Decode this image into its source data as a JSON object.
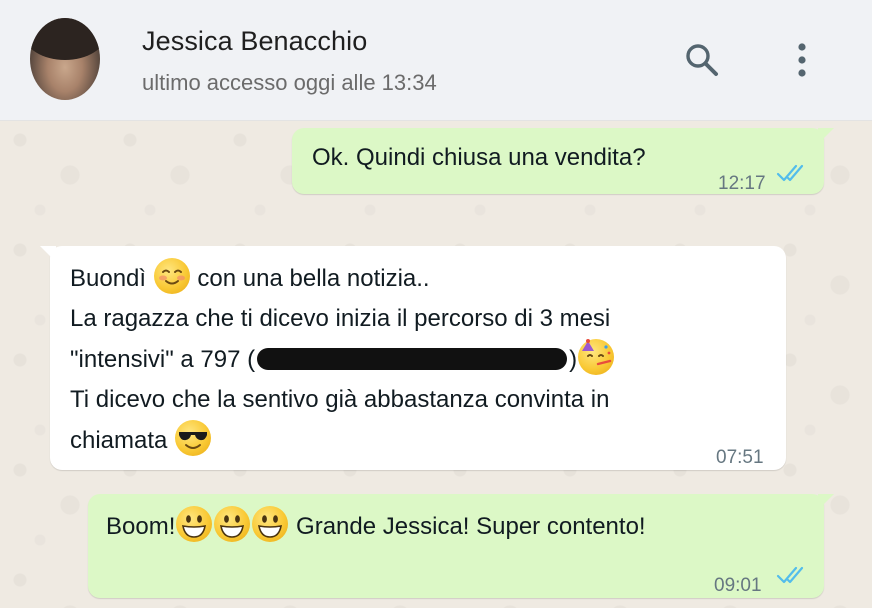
{
  "header": {
    "contact_name": "Jessica Benacchio",
    "status": "ultimo accesso oggi alle 13:34",
    "icons": [
      "search-icon",
      "more-vertical-icon"
    ]
  },
  "messages": [
    {
      "direction": "outgoing",
      "text": "Ok. Quindi chiusa una vendita?",
      "time": "12:17",
      "read": true
    },
    {
      "direction": "incoming",
      "lines": [
        "Buondì",
        "con una bella notizia..",
        "La ragazza che ti dicevo inizia il percorso di 3 mesi",
        "\"intensivi\" a 797 (",
        ")",
        "Ti dicevo che la sentivo già abbastanza convinta in",
        "chiamata"
      ],
      "emojis": [
        "smiling-blush-emoji",
        "partying-face-emoji",
        "sunglasses-emoji"
      ],
      "time": "07:51"
    },
    {
      "direction": "outgoing",
      "text_start": "Boom!",
      "text_end": "Grande Jessica! Super contento!",
      "emojis": [
        "grinning-face-emoji",
        "grinning-face-emoji",
        "grinning-face-emoji"
      ],
      "time": "09:01",
      "read": true
    }
  ],
  "colors": {
    "outgoing_bubble": "#dcf8c6",
    "incoming_bubble": "#ffffff",
    "read_ticks": "#53bdeb",
    "header_bg": "#f0f2f5",
    "chat_bg": "#efeae2"
  }
}
